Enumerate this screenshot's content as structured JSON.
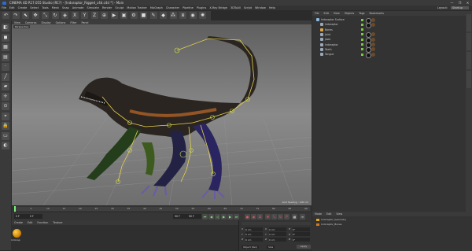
{
  "app": {
    "title": "CINEMA 4D R17.055 Studio (RC?) - [Indoraptor_Rigged_c4d.c4d *] - Main",
    "window_controls": {
      "minimize": "—",
      "maximize": "❐",
      "close": "✕"
    }
  },
  "menubar": {
    "items": [
      "File",
      "Edit",
      "Create",
      "Select",
      "Tools",
      "Mesh",
      "Snap",
      "Animate",
      "Simulate",
      "Render",
      "Sculpt",
      "Motion Tracker",
      "MoGraph",
      "Character",
      "Pipeline",
      "Plugins",
      "X-Ray Bridge",
      "3DToAll",
      "Script",
      "Window",
      "Help"
    ],
    "layout_label": "Layout:",
    "layout_value": "Startup"
  },
  "toolbar": {
    "icons": [
      "undo-icon",
      "redo-icon",
      "live-selection-icon",
      "move-icon",
      "scale-icon",
      "rotate-icon",
      "recent-tool-icon",
      "x-axis-icon",
      "y-axis-icon",
      "z-axis-icon",
      "coordinate-system-icon",
      "render-view-icon",
      "render-picture-viewer-icon",
      "render-settings-icon",
      "cube-icon",
      "pen-icon",
      "subdivision-icon",
      "array-icon",
      "symmetry-icon",
      "camera-icon",
      "light-icon"
    ],
    "glyphs": [
      "↶",
      "↷",
      "⬉",
      "✥",
      "⤡",
      "↻",
      "◈",
      "X",
      "Y",
      "Z",
      "⊕",
      "▶",
      "▣",
      "⚙",
      "■",
      "✎",
      "◆",
      "⁂",
      "⧈",
      "◉",
      "✺"
    ]
  },
  "left_tools": {
    "icons": [
      "make-editable-icon",
      "model-mode-icon",
      "texture-mode-icon",
      "workplane-icon",
      "points-mode-icon",
      "edges-mode-icon",
      "polygons-mode-icon",
      "enable-axis-icon",
      "tweak-icon",
      "snap-icon",
      "lock-workplane-icon",
      "planar-workplane-icon",
      "solo-icon"
    ],
    "glyphs": [
      "◧",
      "◼",
      "▦",
      "▤",
      "·",
      "╱",
      "▰",
      "✛",
      "⊙",
      "⌖",
      "🔒",
      "▭",
      "◐"
    ]
  },
  "viewport": {
    "menu": [
      "View",
      "Cameras",
      "Display",
      "Options",
      "Filter",
      "Panel"
    ],
    "label": "Perspective",
    "grid_info": "Grid Spacing : 100 cm"
  },
  "timeline": {
    "ticks": [
      "0",
      "5",
      "10",
      "15",
      "20",
      "25",
      "30",
      "35",
      "40",
      "45",
      "50",
      "55",
      "60",
      "65",
      "70",
      "75",
      "80",
      "85",
      "90"
    ],
    "current_frame_field": "0 F",
    "start_frame": "0 F",
    "end_frame": "90 F",
    "end_frame_max": "90 F",
    "frame_indicator": "0 F"
  },
  "bottom_left": {
    "menu": [
      "Create",
      "Edit",
      "Function",
      "Texture"
    ],
    "material_name": "Indorap"
  },
  "coordinates": {
    "rows": [
      {
        "axis": "X",
        "pos": "0 cm",
        "rot_axis": "X",
        "rot": "0 cm",
        "h_label": "H",
        "h": "0°"
      },
      {
        "axis": "Y",
        "pos": "0 cm",
        "rot_axis": "Y",
        "rot": "0 cm",
        "h_label": "P",
        "h": "0°"
      },
      {
        "axis": "Z",
        "pos": "0 cm",
        "rot_axis": "Z",
        "rot": "0 cm",
        "h_label": "B",
        "h": "0°"
      }
    ],
    "mode_left": "Object (Rel)",
    "mode_right": "Size",
    "apply": "Apply"
  },
  "object_manager": {
    "menu": [
      "File",
      "Edit",
      "View",
      "Objects",
      "Tags",
      "Bookmarks"
    ],
    "objects": [
      {
        "name": "Indoraptor Surface",
        "indent": 0,
        "color": "#8bbbe0"
      },
      {
        "name": "Indoraptor",
        "indent": 1,
        "color": "#9aa8b8"
      },
      {
        "name": "Bones",
        "indent": 1,
        "color": "#d9a44a"
      },
      {
        "name": "Joint",
        "indent": 1,
        "color": "#9aa8b8"
      },
      {
        "name": "Jaws",
        "indent": 1,
        "color": "#9aa8b8"
      },
      {
        "name": "Indoraptor",
        "indent": 1,
        "color": "#9aa8b8"
      },
      {
        "name": "Teeth",
        "indent": 1,
        "color": "#9aa8b8"
      },
      {
        "name": "Tongue",
        "indent": 1,
        "color": "#9aa8b8"
      }
    ]
  },
  "attributes": {
    "menu": [
      "Mode",
      "Edit",
      "View"
    ],
    "layers": [
      {
        "name": "Indoraptor_Geometry",
        "color": "#e6a31c"
      },
      {
        "name": "Indoraptor_Bones",
        "color": "#d27a1e"
      }
    ]
  },
  "side_tabs": [
    "Objects",
    "Takes",
    "Content Browser",
    "Structure"
  ],
  "colors": {
    "accent": "#2d6bd3",
    "timeline_play": "#7cf27a",
    "record": "#e55555",
    "bone": "#e8d24a"
  }
}
